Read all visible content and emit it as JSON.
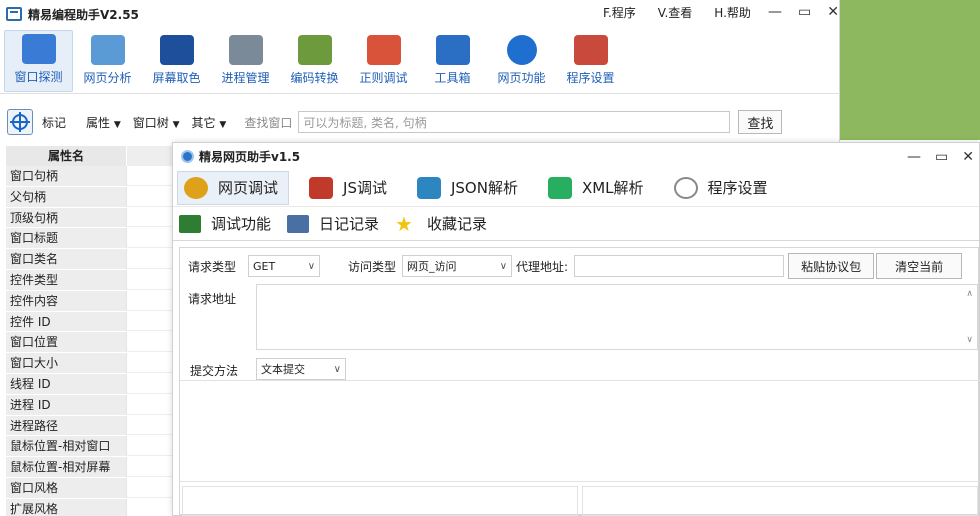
{
  "app": {
    "title": "精易编程助手V2.55"
  },
  "menu": [
    {
      "label": "F.程序"
    },
    {
      "label": "V.查看"
    },
    {
      "label": "H.帮助"
    }
  ],
  "toolbar": [
    {
      "label": "窗口探测",
      "icon": "window-probe-icon",
      "color": "#3a7bd5"
    },
    {
      "label": "网页分析",
      "icon": "web-analysis-icon",
      "color": "#5b9bd5"
    },
    {
      "label": "屏幕取色",
      "icon": "color-picker-icon",
      "color": "#1e4f9a"
    },
    {
      "label": "进程管理",
      "icon": "process-icon",
      "color": "#7a8a99"
    },
    {
      "label": "编码转换",
      "icon": "encode-icon",
      "color": "#6d9a3c"
    },
    {
      "label": "正则调试",
      "icon": "regex-icon",
      "color": "#d9533b"
    },
    {
      "label": "工具箱",
      "icon": "toolbox-icon",
      "color": "#2b6fc4"
    },
    {
      "label": "网页功能",
      "icon": "globe-icon",
      "color": "#1f6fd0"
    },
    {
      "label": "程序设置",
      "icon": "settings-icon",
      "color": "#c94a3d"
    }
  ],
  "searchbar": {
    "mark_label": "标记",
    "dropdowns": [
      "属性",
      "窗口树",
      "其它"
    ],
    "find_label": "查找窗口",
    "find_placeholder": "可以为标题, 类名, 句柄",
    "find_button": "查找"
  },
  "props": {
    "header": "属性名",
    "rows": [
      "窗口句柄",
      "父句柄",
      "顶级句柄",
      "窗口标题",
      "窗口类名",
      "控件类型",
      "控件内容",
      "控件 ID",
      "窗口位置",
      "窗口大小",
      "线程 ID",
      "进程 ID",
      "进程路径",
      "鼠标位置-相对窗口",
      "鼠标位置-相对屏幕",
      "窗口风格",
      "扩展风格"
    ]
  },
  "child": {
    "title": "精易网页助手v1.5",
    "tabs": [
      {
        "label": "网页调试",
        "icon": "web-debug-icon",
        "color": "#e0a11a"
      },
      {
        "label": "JS调试",
        "icon": "js-debug-icon",
        "color": "#c0392b"
      },
      {
        "label": "JSON解析",
        "icon": "json-icon",
        "color": "#2e86c1"
      },
      {
        "label": "XML解析",
        "icon": "xml-icon",
        "color": "#27ae60"
      },
      {
        "label": "程序设置",
        "icon": "gear-icon",
        "color": "#888888"
      }
    ],
    "subtabs": [
      {
        "label": "调试功能",
        "icon": "debug-icon",
        "color": "#2e7d32"
      },
      {
        "label": "日记记录",
        "icon": "log-icon",
        "color": "#4a6fa5"
      },
      {
        "label": "收藏记录",
        "icon": "star-icon",
        "color": "#f1c40f"
      }
    ],
    "form": {
      "req_type_label": "请求类型",
      "req_type_value": "GET",
      "visit_type_label": "访问类型",
      "visit_type_value": "网页_访问",
      "proxy_label": "代理地址:",
      "proxy_value": "",
      "paste_button": "粘贴协议包",
      "clear_button": "清空当前",
      "url_label": "请求地址",
      "submit_label": "提交方法",
      "submit_value": "文本提交"
    }
  }
}
